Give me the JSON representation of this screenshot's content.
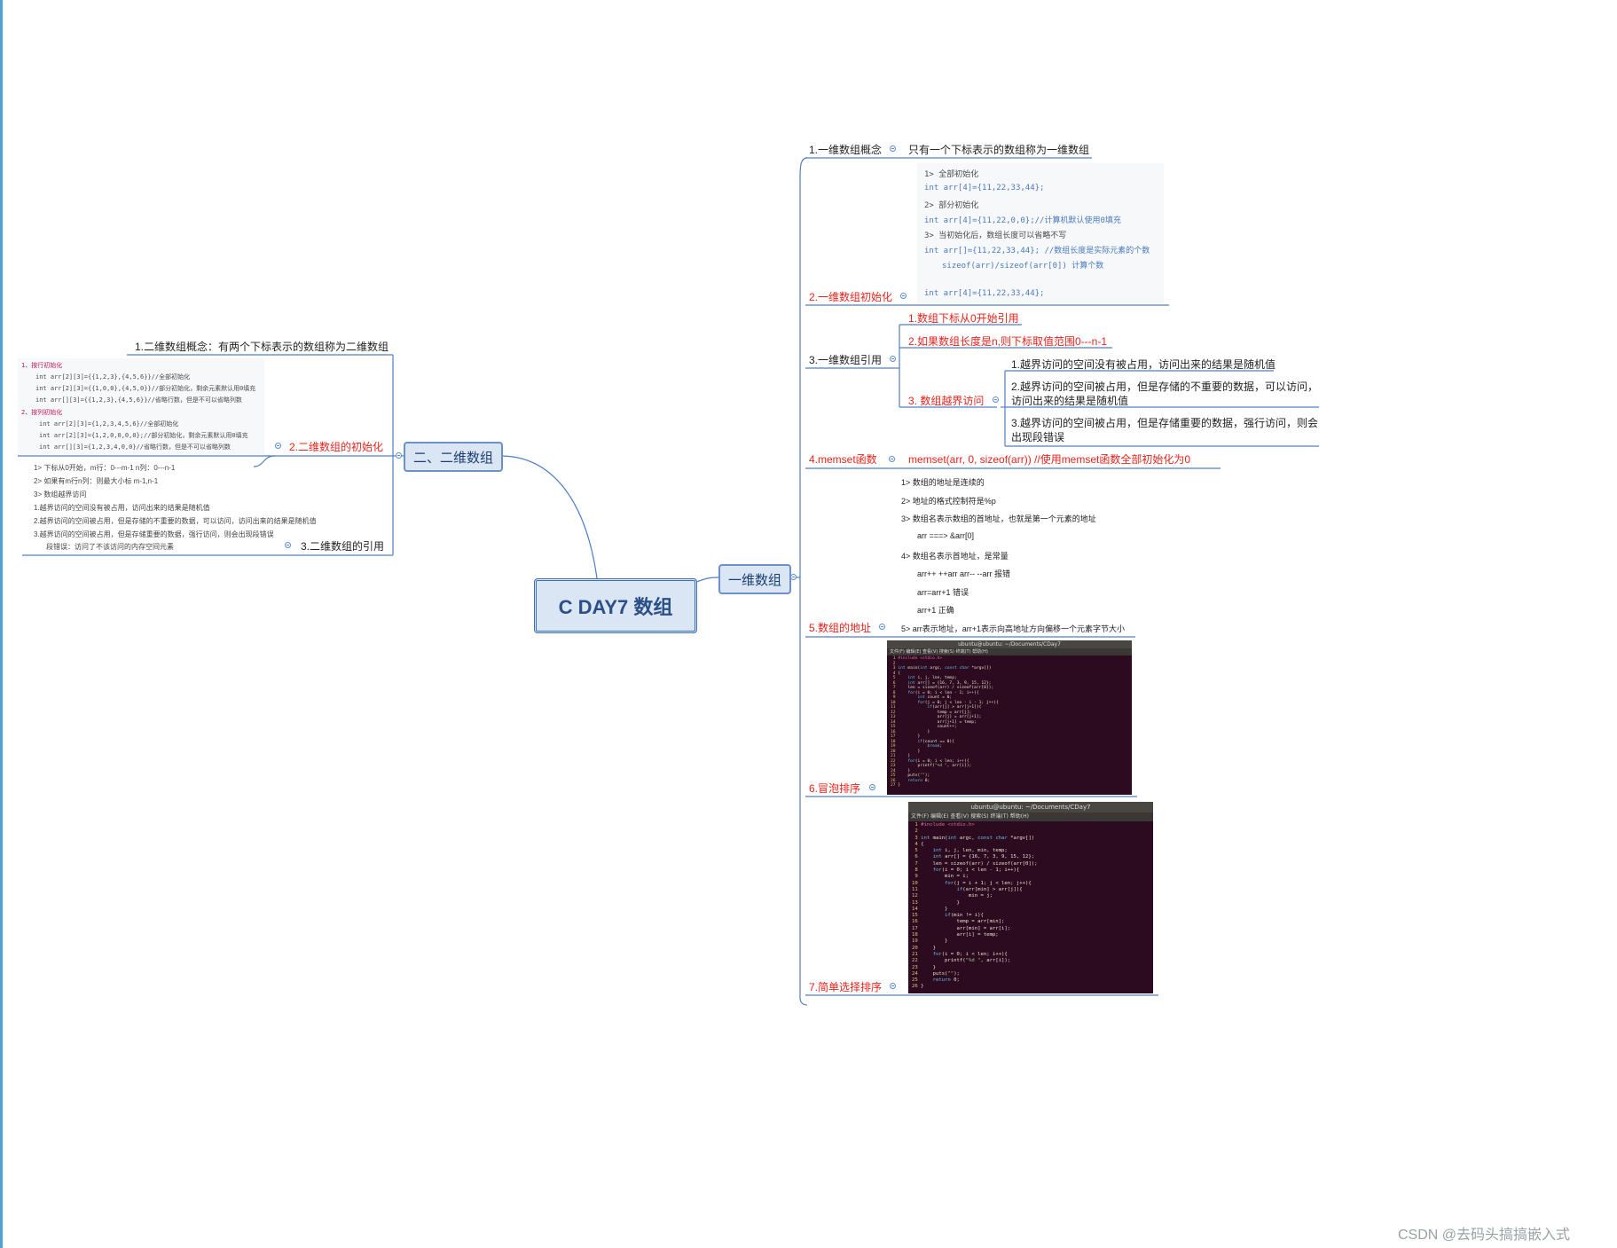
{
  "root": {
    "label": "C DAY7 数组"
  },
  "left_branch": {
    "label": "二、二维数组",
    "concept": "1.二维数组概念：有两个下标表示的数组称为二维数组",
    "init_title": "2.二维数组的初始化",
    "init_lines": [
      "1、按行初始化",
      "int arr[2][3]={{1,2,3},{4,5,6}}//全部初始化",
      "int arr[2][3]={{1,0,0},{4,5,0}}//部分初始化，剩余元素默认用0填充",
      "int arr[][3]={{1,2,3},{4,5,6}}//省略行数，但是不可以省略列数",
      "2、按列初始化",
      "int arr[2][3]={1,2,3,4,5,6}//全部初始化",
      "int arr[2][3]={1,2,0,0,0,0};//部分初始化，剩余元素默认用0填充",
      "int arr[][3]={1,2,3,4,0,0}//省略行数，但是不可以省略列数"
    ],
    "ref_title": "3.二维数组的引用",
    "ref_lines": [
      "1> 下标从0开始，m行：0---m-1   n列：0---n-1",
      "2> 如果有m行n列：则最大小标 m-1,n-1",
      "3> 数组越界访问",
      "1.越界访问的空间没有被占用，访问出来的结果是随机值",
      "2.越界访问的空间被占用，但是存储的不重要的数据，可以访问，访问出来的结果是随机值",
      "3.越界访问的空间被占用，但是存储重要的数据，强行访问，则会出现段错误",
      "段错误：访问了不该访问的内存空间元素"
    ]
  },
  "right_branch": {
    "label": "一维数组",
    "concept_title": "1.一维数组概念",
    "concept_text": "只有一个下标表示的数组称为一维数组",
    "init_title": "2.一维数组初始化",
    "init_code": [
      "1> 全部初始化",
      "int arr[4]={11,22,33,44};",
      "2> 部分初始化",
      "int arr[4]={11,22,0,0};//计算机默认使用0填充",
      "3> 当初始化后，数组长度可以省略不写",
      "int arr[]={11,22,33,44};  //数组长度是实际元素的个数",
      "sizeof(arr)/sizeof(arr[0])    计算个数",
      "int arr[4]={11,22,33,44};"
    ],
    "ref_title": "3.一维数组引用",
    "ref_items": [
      "1.数组下标从0开始引用",
      "2.如果数组长度是n,则下标取值范围0---n-1"
    ],
    "oob_title": "3. 数组越界访问",
    "oob_items": [
      "1.越界访问的空间没有被占用，访问出来的结果是随机值",
      "2.越界访问的空间被占用，但是存储的不重要的数据，可以访问，",
      "访问出来的结果是随机值",
      "3.越界访问的空间被占用，但是存储重要的数据，强行访问，则会",
      "出现段错误"
    ],
    "memset_title": "4.memset函数",
    "memset_text": "memset(arr, 0, sizeof(arr))       //使用memset函数全部初始化为0",
    "addr_title": "5.数组的地址",
    "addr_lines": [
      "1> 数组的地址是连续的",
      "2> 地址的格式控制符是%p",
      "3> 数组名表示数组的首地址，也就是第一个元素的地址",
      "arr ===> &arr[0]",
      "4> 数组名表示首地址，是常量",
      "arr++    ++arr    arr--    --arr    报错",
      "arr=arr+1     错误",
      "arr+1      正确",
      "5> arr表示地址，arr+1表示向高地址方向偏移一个元素字节大小"
    ],
    "bubble_title": "6.冒泡排序",
    "select_title": "7.简单选择排序"
  },
  "terminal_bubble": {
    "title": "ubuntu@ubuntu: ~/Documents/CDay7",
    "menu": "文件(F)  编辑(E)  查看(V)  搜索(S)  终端(T)  帮助(H)",
    "lines": [
      "#include <stdio.h>",
      "",
      "int main(int argc, const char *argv[])",
      "{",
      "    int i, j, len, temp;",
      "    int arr[] = {16, 7, 3, 9, 15, 12};",
      "    len = sizeof(arr) / sizeof(arr[0]);",
      "    for(i = 0; i < len - 1; i++){",
      "        int count = 0;",
      "        for(j = 0; j < len - i - 1; j++){",
      "            if(arr[j] > arr[j+1]){",
      "                temp = arr[j];",
      "                arr[j] = arr[j+1];",
      "                arr[j+1] = temp;",
      "                count++;",
      "            }",
      "        }",
      "        if(count == 0){",
      "            break;",
      "        }",
      "    }",
      "    for(i = 0; i < len; i++){",
      "        printf(\"%d \", arr[i]);",
      "    }",
      "    puts(\"\");",
      "    return 0;",
      "}"
    ]
  },
  "terminal_select": {
    "title": "ubuntu@ubuntu: ~/Documents/CDay7",
    "menu": "文件(F)  编辑(E)  查看(V)  搜索(S)  终端(T)  帮助(H)",
    "lines": [
      "#include <stdio.h>",
      "",
      "int main(int argc, const char *argv[])",
      "{",
      "    int i, j, len, min, temp;",
      "    int arr[] = {16, 7, 3, 9, 15, 12};",
      "    len = sizeof(arr) / sizeof(arr[0]);",
      "    for(i = 0; i < len - 1; i++){",
      "        min = i;",
      "        for(j = i + 1; j < len; j++){",
      "            if(arr[min] > arr[j]){",
      "                min = j;",
      "            }",
      "        }",
      "        if(min != i){",
      "            temp = arr[min];",
      "            arr[min] = arr[i];",
      "            arr[i] = temp;",
      "        }",
      "    }",
      "    for(i = 0; i < len; i++){",
      "        printf(\"%d \", arr[i]);",
      "    }",
      "    puts(\"\");",
      "    return 0;",
      "}"
    ]
  },
  "watermark": "CSDN @去码头搞搞嵌入式",
  "colors": {
    "accent_line": "#4f7fc2",
    "red_text": "#e8231b",
    "node_fill": "#dbe6f4",
    "terminal_bg": "#2c0a1f"
  }
}
